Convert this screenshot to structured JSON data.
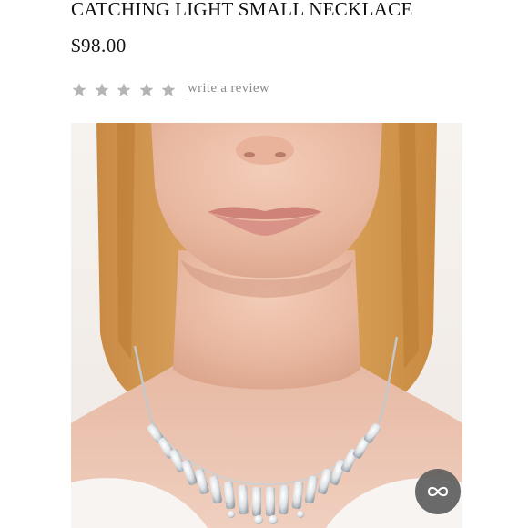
{
  "product": {
    "title": "CATCHING LIGHT SMALL NECKLACE",
    "price": "$98.00"
  },
  "rating": {
    "stars": 0,
    "max_stars": 5,
    "star_icon": "star-icon",
    "review_link": "write a review"
  },
  "photo": {
    "subject": "product-photo"
  },
  "overlay_button": {
    "icon": "infinity-icon"
  },
  "colors": {
    "star_gray": "#b5b5b5",
    "link_gray": "#8a8a8a",
    "button_gray": "#5f5f5f"
  }
}
